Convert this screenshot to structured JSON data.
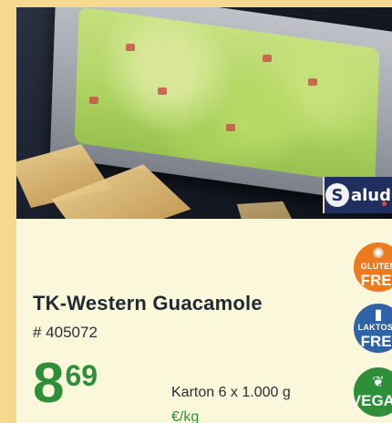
{
  "product": {
    "image_alt": "Guacamole in a tray with tortilla chips",
    "brand_logo": "Salud.",
    "name": "TK-Western Guacamole",
    "sku": "# 405072",
    "price_integer": "8",
    "price_decimal": "69",
    "packaging": "Karton 6 x 1.000 g",
    "unit": "€/kg"
  },
  "badges": [
    {
      "name": "gluten-free",
      "top": "GLUTEN",
      "bottom": "FREI",
      "color": "#ec7a1f",
      "icon": "wheat-icon"
    },
    {
      "name": "lactose-free",
      "top": "LAKTOSE",
      "bottom": "FREI",
      "color": "#2e63a8",
      "icon": "milk-bottle-icon"
    },
    {
      "name": "vegan",
      "top": "",
      "bottom": "VEGAN",
      "color": "#2f8f39",
      "icon": "leaf-icon"
    }
  ]
}
